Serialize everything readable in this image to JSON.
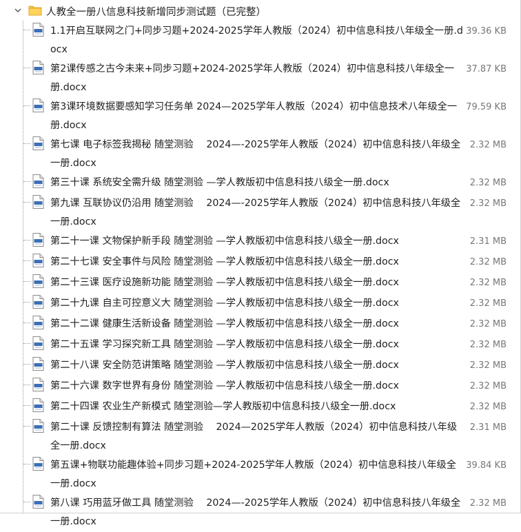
{
  "folder": {
    "name": "人教全一册八信息科技新增同步测试题（已完整）",
    "icon": "folder-icon",
    "expand_icon": "chevron-down-icon"
  },
  "file_icon": "word-doc-icon",
  "files": [
    {
      "name": "1.1开启互联网之门+同步习题+2024-2025学年人教版（2024）初中信息科技八年级全一册.docx",
      "size": "39.36 KB"
    },
    {
      "name": "第2课传感之古今未来+同步习题+2024-2025学年人教版（2024）初中信息科技八年级全一册.docx",
      "size": "37.87 KB"
    },
    {
      "name": "第3课环境数据要感知学习任务单 2024—2025学年人教版（2024）初中信息技术八年级全一册.docx",
      "size": "79.59 KB"
    },
    {
      "name": "第七课 电子标签我揭秘 随堂测验　 2024—-2025学年人教版（2024）初中信息科技八年级全一册.docx",
      "size": "2.32 MB"
    },
    {
      "name": "第三十课 系统安全需升级 随堂测验 —学人教版初中信息科技八级全一册.docx",
      "size": "2.32 MB"
    },
    {
      "name": "第九课 互联协议仍沿用 随堂测验　 2024—-2025学年人教版（2024）初中信息科技八年级全一册.docx",
      "size": "2.32 MB"
    },
    {
      "name": "第二十一课 文物保护新手段 随堂测验 —学人教版初中信息科技八级全一册.docx",
      "size": "2.31 MB"
    },
    {
      "name": "第二十七课 安全事件与风险 随堂测验 —学人教版初中信息科技八级全一册.docx",
      "size": "2.32 MB"
    },
    {
      "name": "第二十三课 医疗设施新功能 随堂测验 —学人教版初中信息科技八级全一册.docx",
      "size": "2.32 MB"
    },
    {
      "name": "第二十九课 自主可控意义大 随堂测验 —学人教版初中信息科技八级全一册.docx",
      "size": "2.32 MB"
    },
    {
      "name": "第二十二课 健康生活新设备 随堂测验 —学人教版初中信息科技八级全一册.docx",
      "size": "2.32 MB"
    },
    {
      "name": "第二十五课 学习探究新工具 随堂测验 —学人教版初中信息科技八级全一册.docx",
      "size": "2.32 MB"
    },
    {
      "name": "第二十八课 安全防范讲策略 随堂测验 —学人教版初中信息科技八级全一册.docx",
      "size": "2.32 MB"
    },
    {
      "name": "第二十六课 数字世界有身份 随堂测验 —学人教版初中信息科技八级全一册.docx",
      "size": "2.32 MB"
    },
    {
      "name": "第二十四课 农业生产新模式 随堂测验—学人教版初中信息科技八级全一册.docx",
      "size": "2.32 MB"
    },
    {
      "name": "第二十课 反馈控制有算法 随堂测验　 2024—2025学年人教版（2024）初中信息科技八年级全一册.docx",
      "size": "2.31 MB"
    },
    {
      "name": "第五课+物联功能趣体验+同步习题+2024-2025学年人教版（2024）初中信息科技八年级全一册.docx",
      "size": "39.84 KB"
    },
    {
      "name": "第八课 巧用蓝牙做工具 随堂测验　 2024—-2025学年人教版（2024）初中信息科技八年级全一册.docx",
      "size": "2.32 MB"
    }
  ]
}
